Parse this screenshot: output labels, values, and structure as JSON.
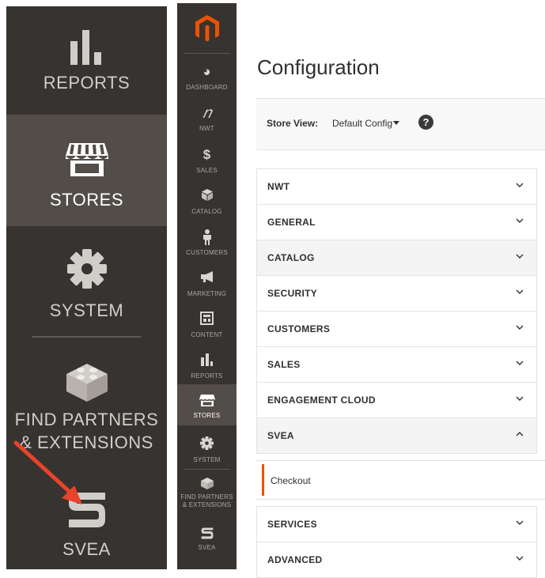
{
  "big_sidebar": {
    "items": [
      {
        "label": "REPORTS"
      },
      {
        "label": "STORES"
      },
      {
        "label": "SYSTEM"
      },
      {
        "label_line1": "FIND PARTNERS",
        "label_line2": "& EXTENSIONS"
      },
      {
        "label": "SVEA"
      }
    ],
    "icons": [
      "bar-chart-icon",
      "store-icon",
      "gear-icon",
      "lego-brick-icon",
      "svea-logo-icon"
    ],
    "active_item": "STORES",
    "arrow_color": "#e8432b"
  },
  "nav": {
    "logo": "magento-logo",
    "items": [
      {
        "label": "DASHBOARD",
        "icon": "dashboard-icon"
      },
      {
        "label": "NWT",
        "icon": "nwt-icon"
      },
      {
        "label": "SALES",
        "icon": "dollar-icon"
      },
      {
        "label": "CATALOG",
        "icon": "box-icon"
      },
      {
        "label": "CUSTOMERS",
        "icon": "person-icon"
      },
      {
        "label": "MARKETING",
        "icon": "megaphone-icon"
      },
      {
        "label": "CONTENT",
        "icon": "layout-icon"
      },
      {
        "label": "REPORTS",
        "icon": "bar-chart-icon"
      },
      {
        "label": "STORES",
        "icon": "store-icon"
      },
      {
        "label": "SYSTEM",
        "icon": "gear-icon"
      },
      {
        "label": "FIND PARTNERS",
        "label2": "& EXTENSIONS",
        "icon": "lego-brick-icon"
      },
      {
        "label": "SVEA",
        "icon": "svea-logo-icon"
      }
    ],
    "active_item": "STORES",
    "accent_color": "#eb5202"
  },
  "main": {
    "title": "Configuration",
    "store_view_label": "Store View:",
    "store_view_value": "Default Config",
    "help_symbol": "?",
    "sections": [
      {
        "label": "NWT",
        "expanded": false
      },
      {
        "label": "GENERAL",
        "expanded": false
      },
      {
        "label": "CATALOG",
        "expanded": false
      },
      {
        "label": "SECURITY",
        "expanded": false
      },
      {
        "label": "CUSTOMERS",
        "expanded": false
      },
      {
        "label": "SALES",
        "expanded": false
      },
      {
        "label": "ENGAGEMENT CLOUD",
        "expanded": false
      },
      {
        "label": "SVEA",
        "expanded": true,
        "children": [
          "Checkout"
        ]
      },
      {
        "label": "SERVICES",
        "expanded": false
      },
      {
        "label": "ADVANCED",
        "expanded": false
      }
    ]
  }
}
